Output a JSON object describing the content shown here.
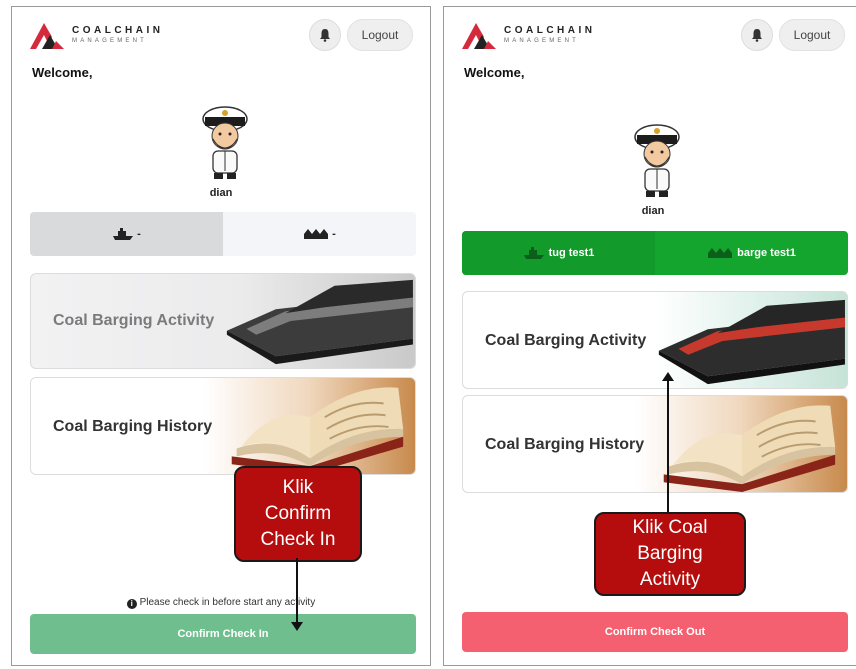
{
  "brand": {
    "name": "COALCHAIN",
    "sub": "MANAGEMENT"
  },
  "header": {
    "logout_label": "Logout",
    "bell_icon": "bell-icon"
  },
  "colors": {
    "green_button": "#6fbf8e",
    "green_tabs": "#14a52e",
    "red_button": "#f4606f",
    "callout": "#b50d0d"
  },
  "screen1": {
    "welcome": "Welcome,",
    "username": "dian",
    "tabs": [
      {
        "label": "-",
        "icon": "tugboat-icon"
      },
      {
        "label": "-",
        "icon": "barge-icon"
      }
    ],
    "cards": [
      {
        "label": "Coal Barging Activity"
      },
      {
        "label": "Coal Barging History"
      }
    ],
    "notice": "Please check in before start any activity",
    "button": "Confirm Check In",
    "callout": "Klik\nConfirm\nCheck In"
  },
  "screen2": {
    "welcome": "Welcome,",
    "username": "dian",
    "tabs": [
      {
        "label": "tug test1",
        "icon": "tugboat-icon"
      },
      {
        "label": "barge test1",
        "icon": "barge-icon"
      }
    ],
    "cards": [
      {
        "label": "Coal Barging Activity"
      },
      {
        "label": "Coal Barging History"
      }
    ],
    "button": "Confirm Check Out",
    "callout": "Klik Coal\nBarging\nActivity"
  }
}
